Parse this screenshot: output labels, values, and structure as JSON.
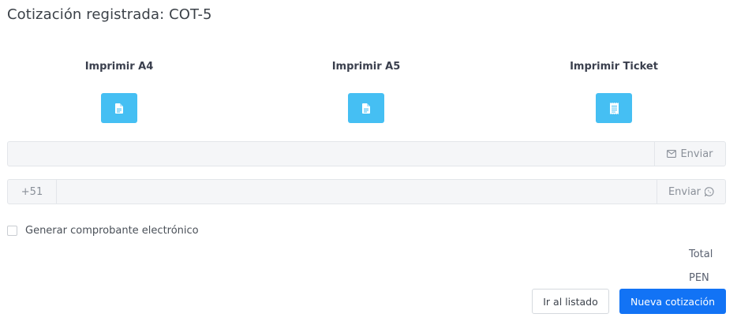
{
  "title": "Cotización registrada: COT-5",
  "print_options": [
    {
      "label": "Imprimir A4",
      "icon": "file-text-icon"
    },
    {
      "label": "Imprimir A5",
      "icon": "file-text-icon"
    },
    {
      "label": "Imprimir Ticket",
      "icon": "receipt-icon"
    }
  ],
  "email": {
    "value": "",
    "placeholder": "",
    "send_label": "Enviar",
    "send_icon": "envelope-icon"
  },
  "whatsapp": {
    "country_code": "+51",
    "value": "",
    "placeholder": "",
    "send_label": "Enviar",
    "send_icon": "whatsapp-icon"
  },
  "generate_receipt": {
    "label": "Generar comprobante electrónico",
    "checked": false
  },
  "summary": {
    "total_label": "Total",
    "currency": "PEN"
  },
  "actions": {
    "go_to_list": "Ir al listado",
    "new_quote": "Nueva cotización"
  },
  "colors": {
    "print_button": "#45bff3",
    "primary": "#1273f5",
    "input_bg": "#f5f6f8"
  }
}
